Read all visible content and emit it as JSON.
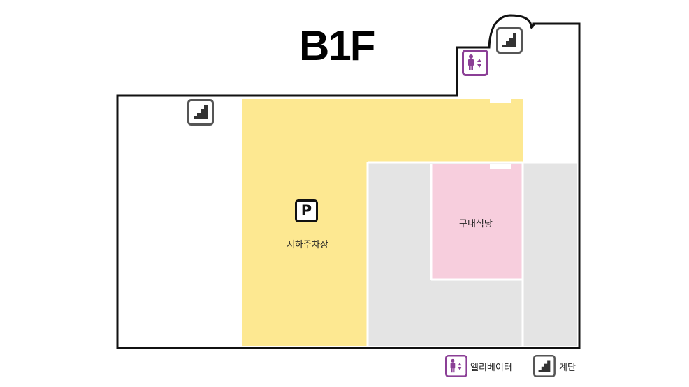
{
  "floor": {
    "title": "B1F"
  },
  "rooms": {
    "parking": {
      "label": "지하주차장",
      "sign": "P",
      "color": "#fde891"
    },
    "cafeteria": {
      "label": "구내식당",
      "color": "#f7cedd"
    },
    "service_area": {
      "color": "#e4e4e4"
    }
  },
  "icons": {
    "stairs": "stairs-icon",
    "elevator": "elevator-icon"
  },
  "legend": {
    "elevator": {
      "label": "엘리베이터",
      "color": "#8b3f96"
    },
    "stairs": {
      "label": "계단",
      "color": "#555555"
    }
  }
}
